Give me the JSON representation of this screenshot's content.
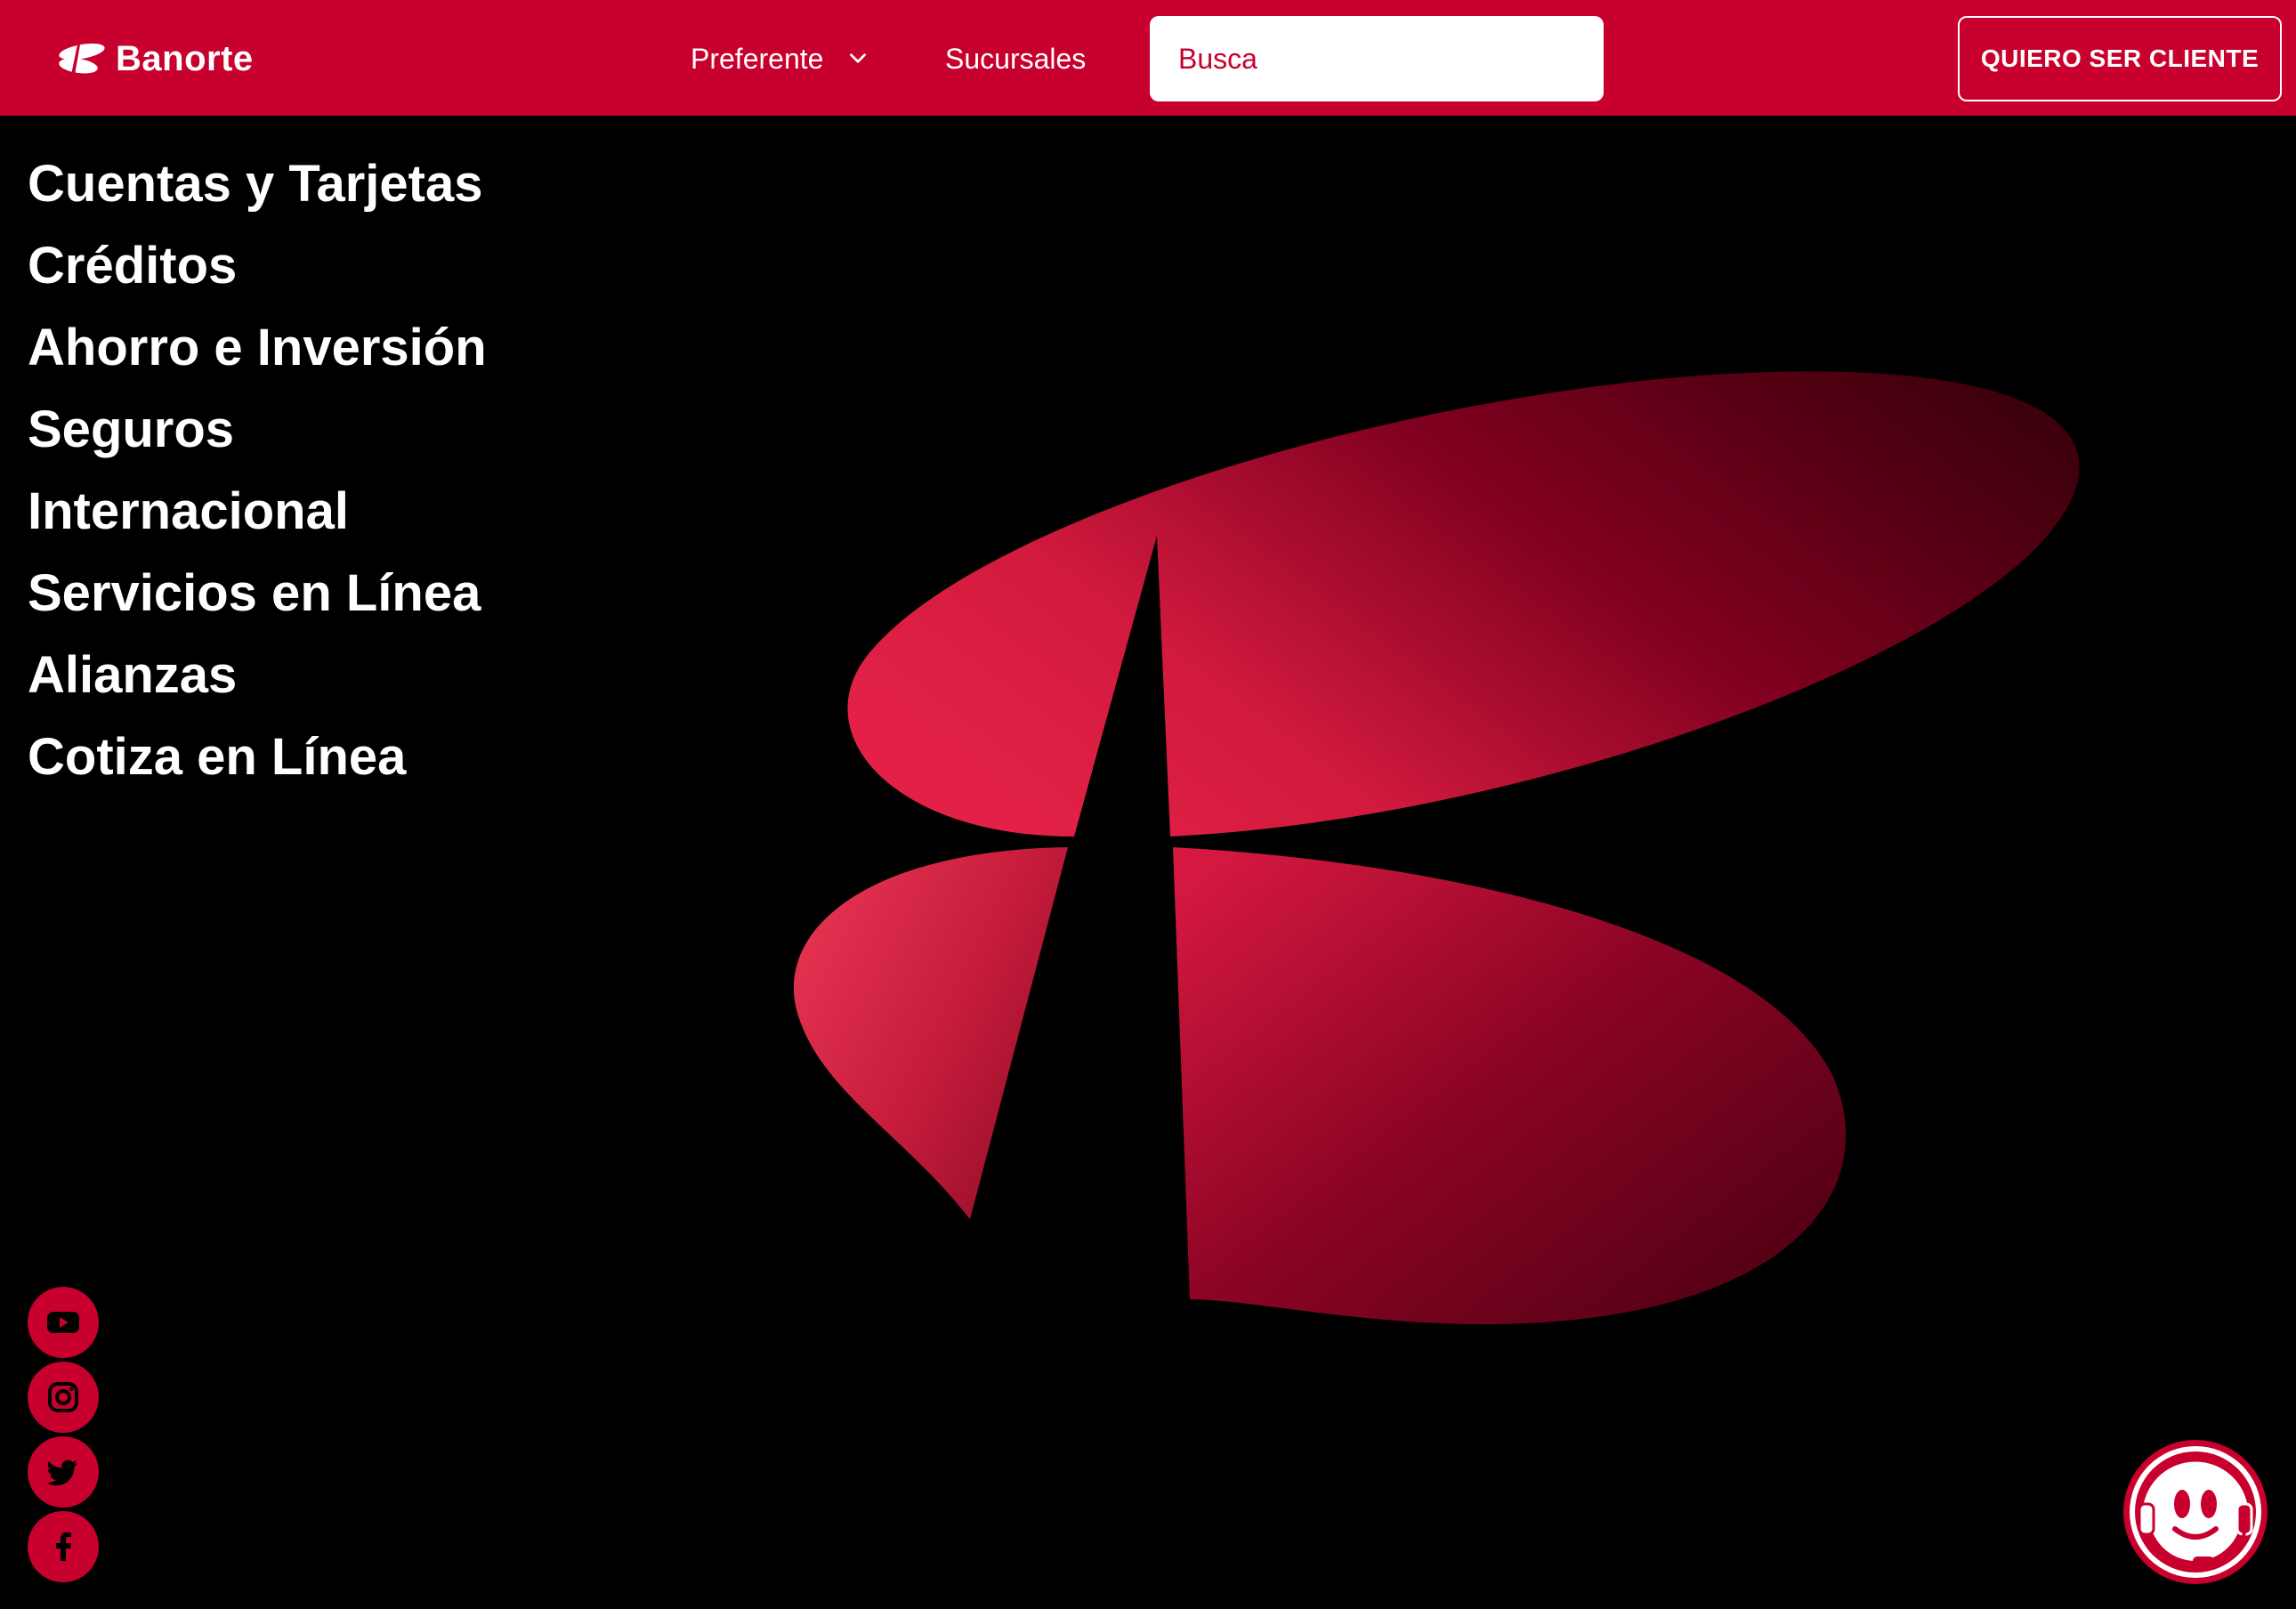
{
  "header": {
    "logo_text": "Banorte",
    "nav": {
      "preferente": "Preferente",
      "sucursales": "Sucursales"
    },
    "search_placeholder": "Busca",
    "cta_label": "QUIERO SER CLIENTE"
  },
  "menu": {
    "items": [
      "Cuentas y Tarjetas",
      "Créditos",
      "Ahorro e Inversión",
      "Seguros",
      "Internacional",
      "Servicios en Línea",
      "Alianzas",
      "Cotiza en Línea"
    ]
  },
  "social": [
    "youtube-icon",
    "instagram-icon",
    "twitter-icon",
    "facebook-icon"
  ],
  "chat": {
    "icon": "chat-assistant-icon"
  },
  "colors": {
    "brand_red": "#c8002d",
    "background": "#000000",
    "text": "#ffffff"
  }
}
